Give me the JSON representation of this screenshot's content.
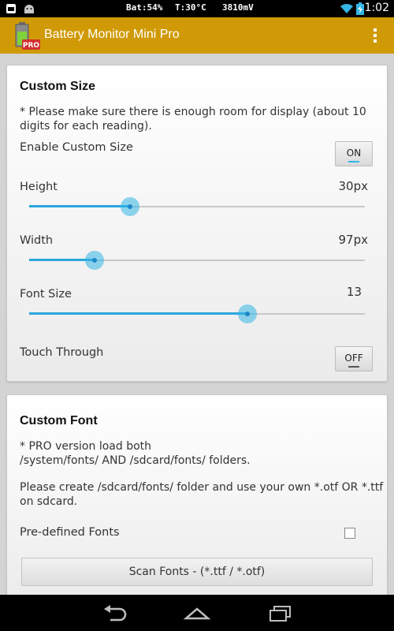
{
  "statusbar": {
    "battery_text": "Bat:54%",
    "temp_text": "T:30°C",
    "voltage_text": "3810mV",
    "time": "1:02"
  },
  "app": {
    "title": "Battery Monitor Mini Pro",
    "icon_badge": "PRO"
  },
  "custom_size": {
    "title": "Custom Size",
    "note": "* Please make sure there is enough room for display (about 10 digits for each reading).",
    "enable_label": "Enable Custom Size",
    "enable_toggle": "ON",
    "height_label": "Height",
    "height_value": "30px",
    "height_level": 0.3,
    "width_label": "Width",
    "width_value": "97px",
    "width_level": 0.195,
    "font_label": "Font Size",
    "font_value": "13",
    "font_level": 0.65,
    "touch_label": "Touch Through",
    "touch_toggle": "OFF"
  },
  "custom_font": {
    "title": "Custom Font",
    "note1_line1": "* PRO version load both",
    "note1_line2": "/system/fonts/ AND /sdcard/fonts/ folders.",
    "note2_line1": "Please create /sdcard/fonts/ folder and use your own *.otf OR *.ttf",
    "note2_line2": "on sdcard.",
    "predefined_label": "Pre-defined Fonts",
    "predefined_checked": false,
    "scan_button": "Scan Fonts - (*.ttf / *.otf)"
  },
  "colors": {
    "actionbar": "#d09a06",
    "accent": "#33b5e5"
  }
}
